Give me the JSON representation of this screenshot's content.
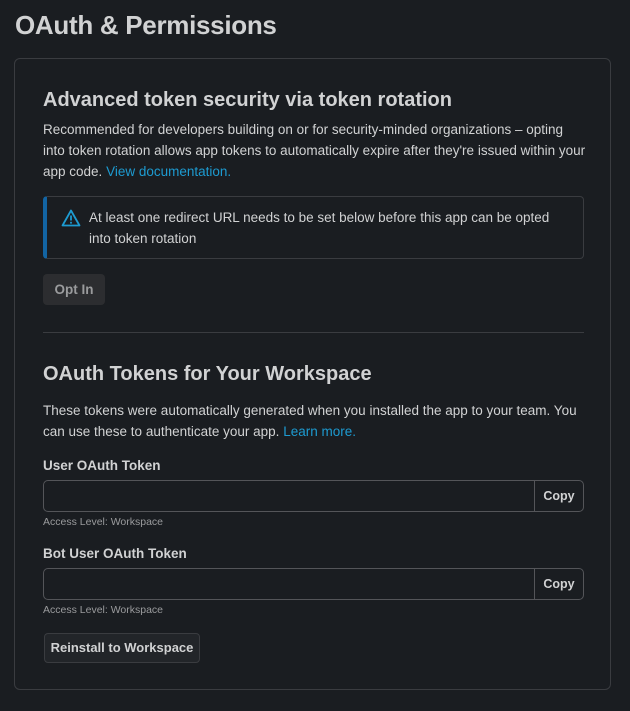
{
  "page": {
    "title": "OAuth & Permissions"
  },
  "token_rotation": {
    "title": "Advanced token security via token rotation",
    "description": "Recommended for developers building on or for security-minded organizations – opting into token rotation allows app tokens to automatically expire after they're issued within your app code.",
    "doc_link": "View documentation.",
    "warning_icon": "warning-triangle-icon",
    "warning_text": "At least one redirect URL needs to be set below before this app can be opted into token rotation",
    "opt_in_label": "Opt In"
  },
  "oauth_tokens": {
    "title": "OAuth Tokens for Your Workspace",
    "description": "These tokens were automatically generated when you installed the app to your team. You can use these to authenticate your app.",
    "learn_link": "Learn more.",
    "user_token": {
      "label": "User OAuth Token",
      "value": "",
      "copy_label": "Copy",
      "access_level": "Access Level: Workspace"
    },
    "bot_token": {
      "label": "Bot User OAuth Token",
      "value": "",
      "copy_label": "Copy",
      "access_level": "Access Level: Workspace"
    },
    "reinstall_label": "Reinstall to Workspace"
  },
  "colors": {
    "background": "#1a1d21",
    "text": "#d1d2d3",
    "link": "#1d9bd1",
    "callout_accent": "#1264a3"
  }
}
